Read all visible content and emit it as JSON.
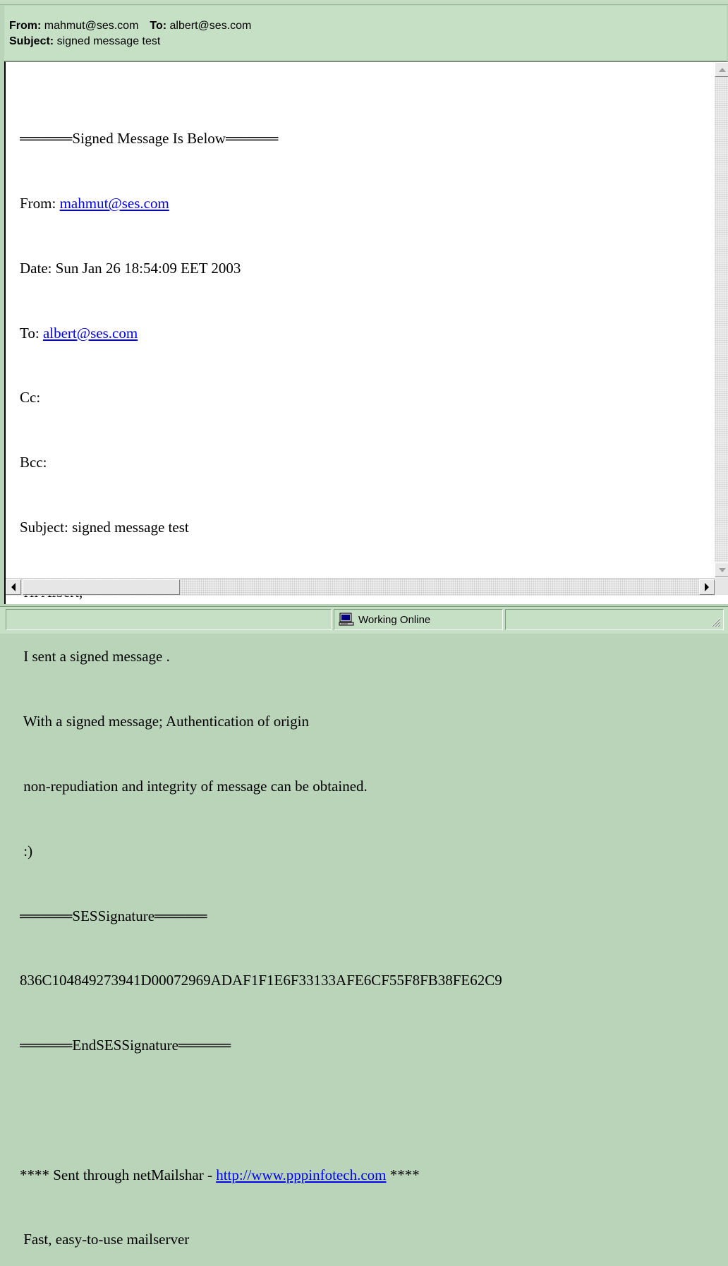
{
  "header": {
    "from_label": "From:",
    "from_value": "mahmut@ses.com",
    "to_label": "To:",
    "to_value": "albert@ses.com",
    "subject_label": "Subject:",
    "subject_value": "signed message test"
  },
  "message": {
    "l01": "═════Signed Message Is Below═════",
    "l02_prefix": "From: ",
    "l02_link": "mahmut@ses.com",
    "l03": "Date: Sun Jan 26 18:54:09 EET 2003",
    "l04_prefix": "To: ",
    "l04_link": "albert@ses.com",
    "l05": "Cc:",
    "l06": "Bcc:",
    "l07": "Subject: signed message test",
    "l08": " Hi Albert,",
    "l09": " I sent a signed message .",
    "l10": " With a signed message; Authentication of origin",
    "l11": " non-repudiation and integrity of message can be obtained.",
    "l12": " :)",
    "l13": "═════SESSignature═════",
    "l14": "836C104849273941D00072969ADAF1F1E6F33133AFE6CF55F8FB38FE62C9",
    "l15": "═════EndSESSignature═════",
    "l16": "",
    "l17_prefix": "**** Sent through netMailshar - ",
    "l17_link": "http://www.pppinfotech.com",
    "l17_suffix": " ****",
    "l18": " Fast, easy-to-use mailserver"
  },
  "status": {
    "connection": "Working Online"
  },
  "icons": {
    "connection": "computer-icon"
  }
}
